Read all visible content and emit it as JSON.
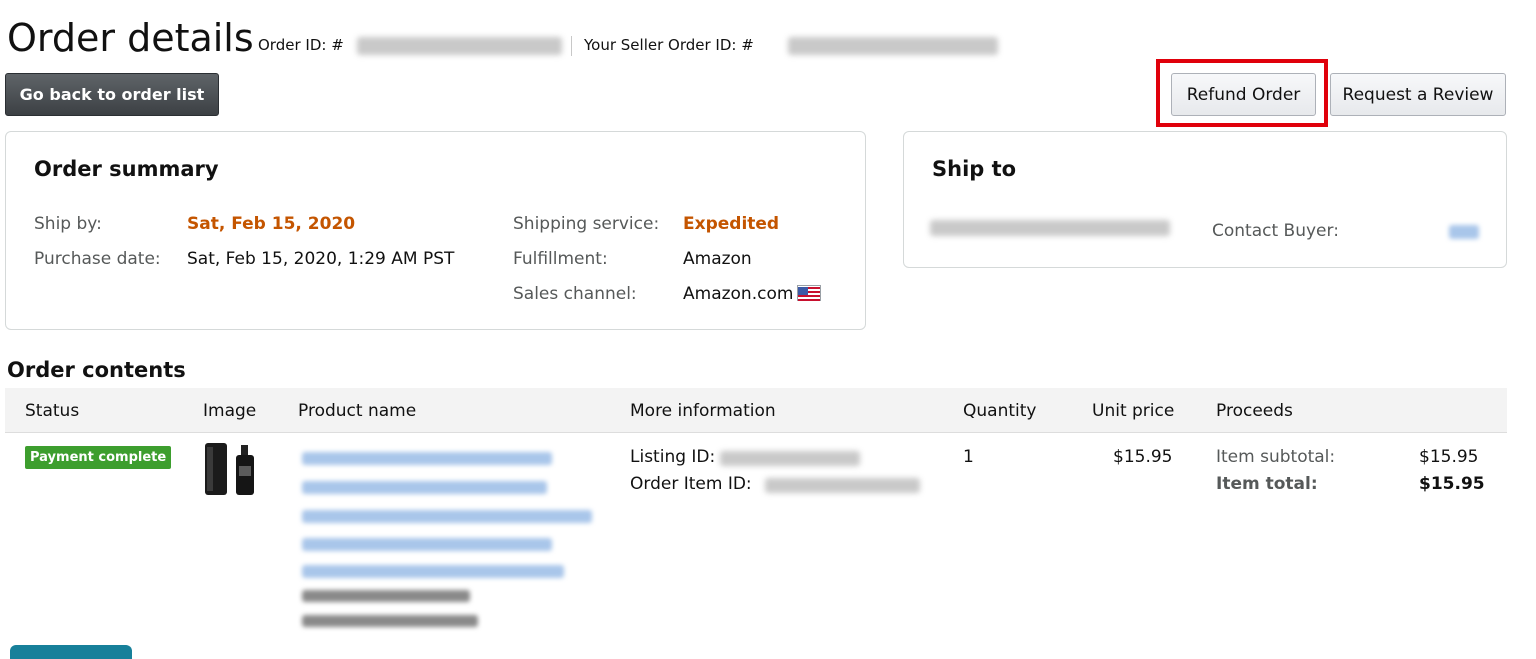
{
  "header": {
    "title": "Order details",
    "order_id_label": "Order ID: #",
    "seller_order_id_label": "Your Seller Order ID: #"
  },
  "buttons": {
    "back": "Go back to order list",
    "refund": "Refund Order",
    "review": "Request a Review"
  },
  "summary": {
    "title": "Order summary",
    "ship_by_label": "Ship by:",
    "ship_by_value": "Sat, Feb 15, 2020",
    "purchase_date_label": "Purchase date:",
    "purchase_date_value": "Sat, Feb 15, 2020, 1:29 AM PST",
    "shipping_service_label": "Shipping service:",
    "shipping_service_value": "Expedited",
    "fulfillment_label": "Fulfillment:",
    "fulfillment_value": "Amazon",
    "sales_channel_label": "Sales channel:",
    "sales_channel_value": "Amazon.com"
  },
  "ship_to": {
    "title": "Ship to",
    "contact_buyer_label": "Contact Buyer:"
  },
  "contents": {
    "title": "Order contents",
    "columns": {
      "status": "Status",
      "image": "Image",
      "product_name": "Product name",
      "more_information": "More information",
      "quantity": "Quantity",
      "unit_price": "Unit price",
      "proceeds": "Proceeds"
    },
    "row": {
      "status": "Payment complete",
      "listing_id_label": "Listing ID:",
      "order_item_id_label": "Order Item ID:",
      "quantity": "1",
      "unit_price": "$15.95",
      "item_subtotal_label": "Item subtotal:",
      "item_subtotal_value": "$15.95",
      "item_total_label": "Item total:",
      "item_total_value": "$15.95"
    }
  },
  "colors": {
    "accent_orange": "#c45500",
    "status_green": "#3d9e2e",
    "highlight_red": "#e0000b",
    "dark_button": "#3c4044"
  },
  "icons": [
    "us-flag-icon",
    "product-image"
  ]
}
